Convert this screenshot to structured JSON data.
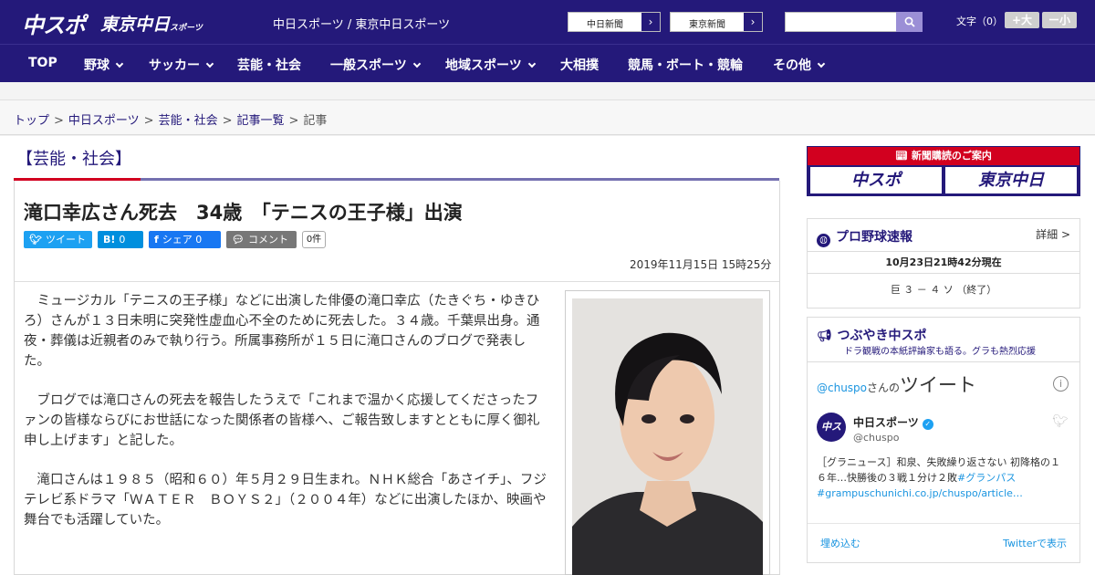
{
  "header": {
    "logo_chunichi": "中スポ",
    "logo_tokyo": "東京中日",
    "logo_tokyo_suffix": "スポーツ",
    "site_names": "中日スポーツ / 東京中日スポーツ",
    "ext_links": [
      {
        "label": "中日新聞",
        "arrow": "›"
      },
      {
        "label": "東京新聞",
        "arrow": "›"
      }
    ],
    "search_placeholder": "",
    "fontsize_label": "文字（0）",
    "fontsize_bigger": "+大",
    "fontsize_smaller": "ー小"
  },
  "nav": {
    "items": [
      {
        "label": "TOP"
      },
      {
        "label": "野球"
      },
      {
        "label": "サッカー"
      },
      {
        "label": "芸能・社会"
      },
      {
        "label": "一般スポーツ"
      },
      {
        "label": "地域スポーツ"
      },
      {
        "label": "大相撲"
      },
      {
        "label": "競馬・ボート・競輪"
      },
      {
        "label": "その他"
      }
    ]
  },
  "breadcrumb": {
    "items": [
      "トップ",
      "中日スポーツ",
      "芸能・社会",
      "記事一覧"
    ],
    "current": "記事",
    "separator": ">"
  },
  "article": {
    "category": "【芸能・社会】",
    "headline": "滝口幸広さん死去　34歳　「テニスの王子様」出演",
    "share": {
      "tweet": "ツイート",
      "hatena_icon": "B!",
      "hatena_count": "0",
      "facebook": "シェア",
      "facebook_count": "0",
      "comment": "コメント",
      "comment_count": "0件"
    },
    "date": "2019年11月15日 15時25分",
    "paragraphs": [
      "ミュージカル「テニスの王子様」などに出演した俳優の滝口幸広（たきぐち・ゆきひろ）さんが１３日未明に突発性虚血心不全のために死去した。３４歳。千葉県出身。通夜・葬儀は近親者のみで執り行う。所属事務所が１５日に滝口さんのブログで発表した。",
      "ブログでは滝口さんの死去を報告したうえで「これまで温かく応援してくださったファンの皆様ならびにお世話になった関係者の皆様へ、ご報告致しますとともに厚く御礼申し上げます」と記した。",
      "滝口さんは１９８５（昭和６０）年５月２９日生まれ。ＮＨＫ総合「あさイチ」、フジテレビ系ドラマ「ＷＡＴＥＲ　ＢＯＹＳ２」（２００４年）などに出演したほか、映画や舞台でも活躍していた。"
    ]
  },
  "sidebar": {
    "promo": {
      "title": "新聞購読のご案内",
      "btn1": "中スポ",
      "btn2": "東京中日"
    },
    "baseball": {
      "title": "プロ野球速報",
      "detail": "詳細 >",
      "timestamp": "10月23日21時42分現在",
      "score": "巨 ３ － ４ ソ （終了）"
    },
    "tweets": {
      "title": "つぶやき中スポ",
      "subtitle": "ドラ観戦の本紙評論家も語る。グラも熱烈応援",
      "handle": "@chuspo",
      "handle_suffix": "さんの",
      "heading_big": "ツイート",
      "info": "i",
      "avatar": "中スポ",
      "account_name": "中日スポーツ",
      "account_handle": "@chuspo",
      "tweet_text": "［グラニュース］和泉、失敗繰り返さない 初降格の１６年…快勝後の３戦１分け２敗",
      "tweet_hashtag": "#グランパス",
      "tweet_link": "#grampuschunichi.co.jp/chuspo/article…",
      "embed": "埋め込む",
      "view": "Twitterで表示"
    }
  },
  "colors": {
    "brand_navy": "#24197a",
    "accent_red": "#d2001f",
    "twitter_blue": "#1da1f2",
    "hatena_blue": "#008fde",
    "facebook_blue": "#1877f2",
    "comment_gray": "#777777"
  }
}
